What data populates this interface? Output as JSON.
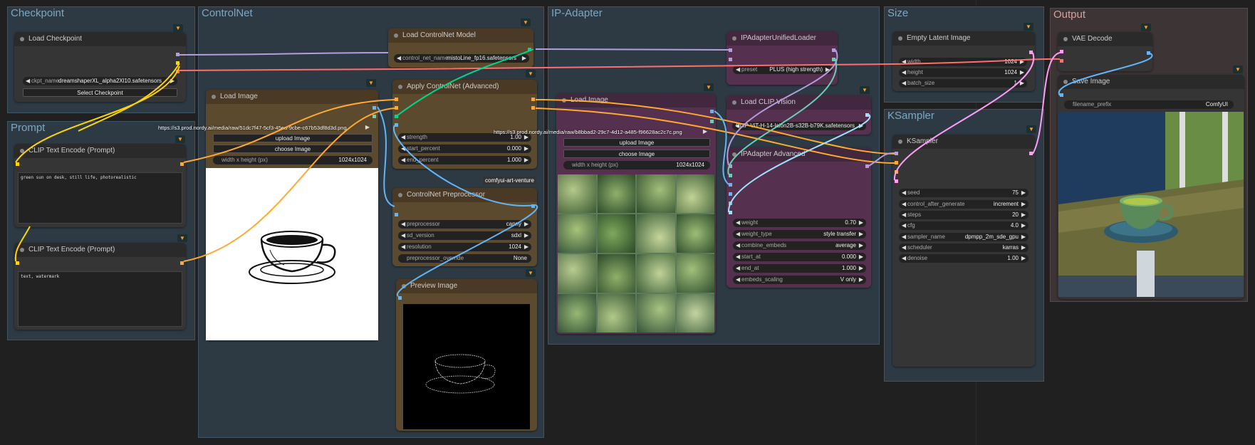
{
  "groups": {
    "checkpoint": "Checkpoint",
    "prompt": "Prompt",
    "controlnet": "ControlNet",
    "ipadapter": "IP-Adapter",
    "size": "Size",
    "ksampler": "KSampler",
    "output": "Output"
  },
  "nodes": {
    "load_checkpoint": {
      "title": "Load Checkpoint",
      "ckpt_label": "ckpt_name",
      "ckpt_value": "dreamshaperXL_alpha2Xl10.safetensors",
      "button": "Select Checkpoint"
    },
    "clip_pos": {
      "title": "CLIP Text Encode (Prompt)",
      "text": "green sun on desk, still life, photorealistic"
    },
    "clip_neg": {
      "title": "CLIP Text Encode (Prompt)",
      "text": "text, watermark"
    },
    "load_controlnet": {
      "title": "Load ControlNet Model",
      "label": "control_net_name",
      "value": "mistoLine_fp16.safetensors"
    },
    "load_image_cn": {
      "title": "Load Image",
      "url": "https://s3.prod.nordy.ai/media/raw/51dc7f47-5cf3-45ea-9cbe-c67b53df8d3d.png",
      "upload": "upload Image",
      "choose": "choose Image",
      "wh_label": "width x height (px)",
      "wh_value": "1024x1024"
    },
    "apply_controlnet": {
      "title": "Apply ControlNet (Advanced)",
      "strength_label": "strength",
      "strength_value": "1.00",
      "start_label": "start_percent",
      "start_value": "0.000",
      "end_label": "end_percent",
      "end_value": "1.000"
    },
    "comfyui_tag": "comfyui-art-venture",
    "cn_preprocessor": {
      "title": "ControlNet Preprocessor",
      "pre_label": "preprocessor",
      "pre_value": "canny",
      "sd_label": "sd_version",
      "sd_value": "sdxl",
      "res_label": "resolution",
      "res_value": "1024",
      "override_label": "preprocessor_override",
      "override_value": "None"
    },
    "preview_image": {
      "title": "Preview Image"
    },
    "load_image_ip": {
      "title": "Load Image",
      "url": "https://s3.prod.nordy.ai/media/raw/b8bbad2-29c7-4d12-a485-f96628ac2c7c.png",
      "upload": "upload Image",
      "choose": "choose Image",
      "wh_label": "width x height (px)",
      "wh_value": "1024x1024"
    },
    "ip_loader": {
      "title": "IPAdapterUnifiedLoader",
      "preset_label": "preset",
      "preset_value": "PLUS (high strength)"
    },
    "load_clip_vision": {
      "title": "Load CLIP Vision",
      "value": "CLIP-ViT-H-14-laion2B-s32B-b79K.safetensors"
    },
    "ip_advanced": {
      "title": "IPAdapter Advanced",
      "weight_label": "weight",
      "weight_value": "0.70",
      "wtype_label": "weight_type",
      "wtype_value": "style transfer",
      "combine_label": "combine_embeds",
      "combine_value": "average",
      "start_label": "start_at",
      "start_value": "0.000",
      "end_label": "end_at",
      "end_value": "1.000",
      "scaling_label": "embeds_scaling",
      "scaling_value": "V only"
    },
    "empty_latent": {
      "title": "Empty Latent Image",
      "width_label": "width",
      "width_value": "1024",
      "height_label": "height",
      "height_value": "1024",
      "batch_label": "batch_size",
      "batch_value": "1"
    },
    "ksampler": {
      "title": "KSampler",
      "seed_label": "seed",
      "seed_value": "75",
      "cag_label": "control_after_generate",
      "cag_value": "increment",
      "steps_label": "steps",
      "steps_value": "20",
      "cfg_label": "cfg",
      "cfg_value": "4.0",
      "sampler_label": "sampler_name",
      "sampler_value": "dpmpp_2m_sde_gpu",
      "scheduler_label": "scheduler",
      "scheduler_value": "karras",
      "denoise_label": "denoise",
      "denoise_value": "1.00"
    },
    "vae_decode": {
      "title": "VAE Decode"
    },
    "save_image": {
      "title": "Save Image",
      "prefix_label": "filename_prefix",
      "prefix_value": "ComfyUI"
    }
  },
  "icons": {
    "badge": "fox-icon",
    "arrow_left": "◀",
    "arrow_right": "▶"
  },
  "colors": {
    "group_blue": "#2d3a44",
    "group_output": "#3d3535",
    "node_brown": "#5c4a2e",
    "node_purple": "#55304f",
    "link_clip": "#ffd500",
    "link_model": "#b39ddb",
    "link_vae": "#ff6e6e",
    "link_latent": "#ff9cf9",
    "link_cond": "#ffa931",
    "link_image": "#64b5f6",
    "link_cn": "#00d68f"
  }
}
